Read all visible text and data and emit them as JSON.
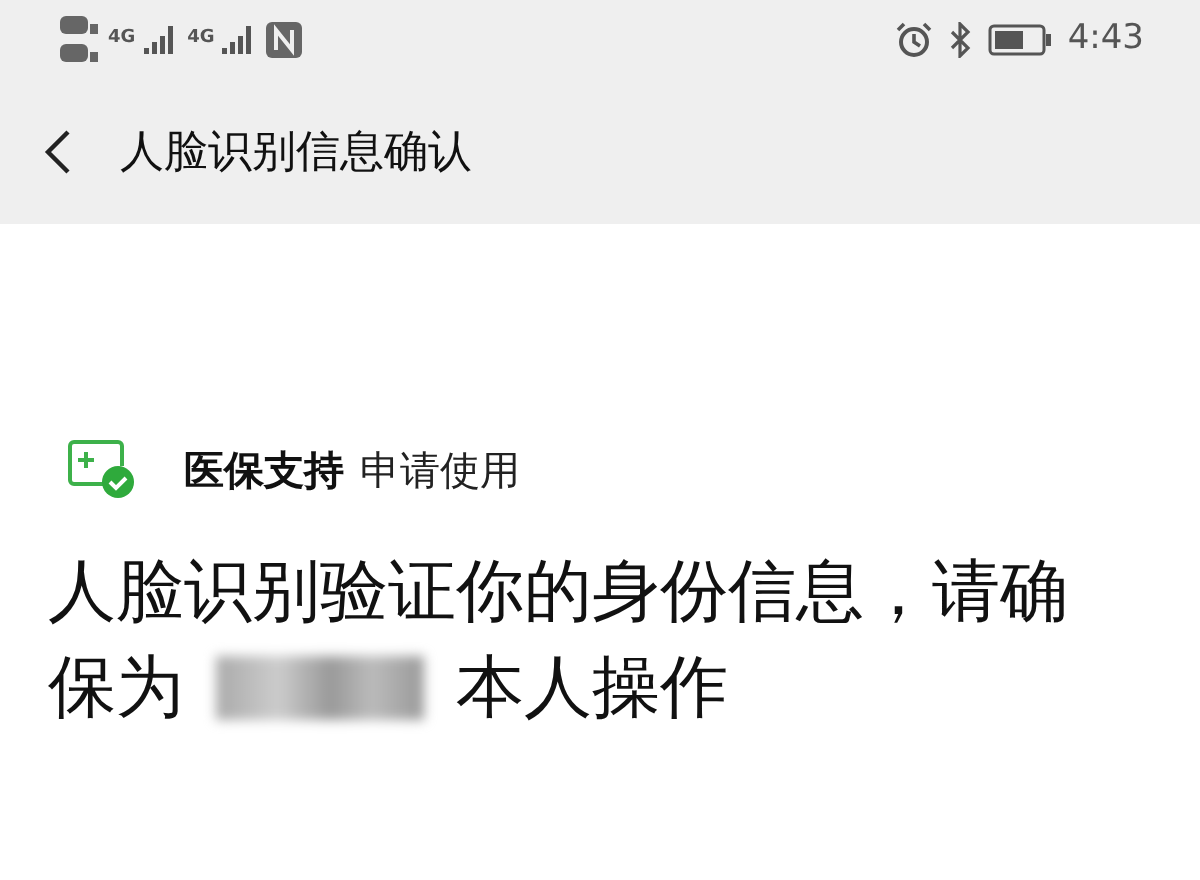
{
  "status_bar": {
    "network_1": "4G",
    "network_2": "4G",
    "time": "4:43"
  },
  "header": {
    "title": "人脸识别信息确认"
  },
  "app": {
    "name": "医保支持",
    "action": "申请使用"
  },
  "message": {
    "line_1": "人脸识别验证你的身份信息，请确",
    "line_2_before": "保为",
    "line_2_after": "本人操作"
  }
}
